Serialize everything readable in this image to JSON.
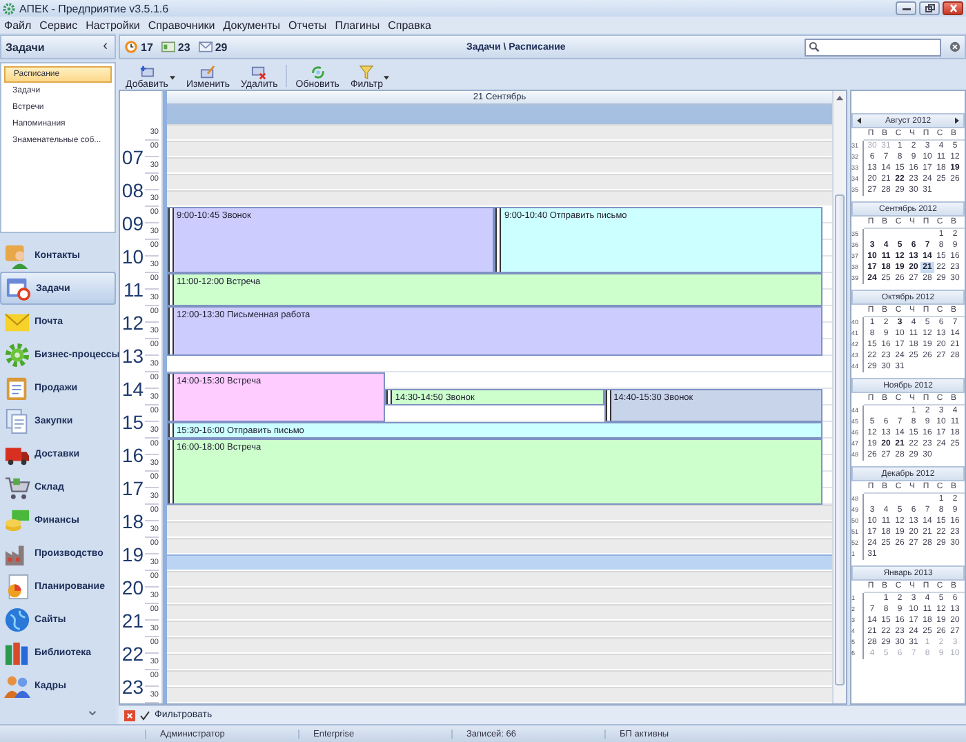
{
  "window": {
    "title": "АПЕК - Предприятие v3.5.1.6"
  },
  "menu": [
    "Файл",
    "Сервис",
    "Настройки",
    "Справочники",
    "Документы",
    "Отчеты",
    "Плагины",
    "Справка"
  ],
  "sidebar": {
    "title": "Задачи",
    "collapse": "‹",
    "tree": [
      {
        "label": "Расписание",
        "selected": true
      },
      {
        "label": "Задачи",
        "selected": false
      },
      {
        "label": "Встречи",
        "selected": false
      },
      {
        "label": "Напоминания",
        "selected": false
      },
      {
        "label": "Знаменательные соб...",
        "selected": false
      }
    ],
    "nav": [
      {
        "label": "Контакты",
        "kind": "person",
        "selected": false
      },
      {
        "label": "Задачи",
        "kind": "calendar",
        "selected": true
      },
      {
        "label": "Почта",
        "kind": "envelope",
        "selected": false
      },
      {
        "label": "Бизнес-процессы",
        "kind": "gear",
        "selected": false
      },
      {
        "label": "Продажи",
        "kind": "clipboard",
        "selected": false
      },
      {
        "label": "Закупки",
        "kind": "documents",
        "selected": false
      },
      {
        "label": "Доставки",
        "kind": "truck",
        "selected": false
      },
      {
        "label": "Склад",
        "kind": "cart",
        "selected": false
      },
      {
        "label": "Финансы",
        "kind": "coins",
        "selected": false
      },
      {
        "label": "Производство",
        "kind": "factory",
        "selected": false
      },
      {
        "label": "Планирование",
        "kind": "piechart",
        "selected": false
      },
      {
        "label": "Сайты",
        "kind": "globe",
        "selected": false
      },
      {
        "label": "Библиотека",
        "kind": "books",
        "selected": false
      },
      {
        "label": "Кадры",
        "kind": "people",
        "selected": false
      }
    ]
  },
  "counters": [
    {
      "kind": "clock",
      "value": "17"
    },
    {
      "kind": "note",
      "value": "23"
    },
    {
      "kind": "envelope",
      "value": "29"
    }
  ],
  "breadcrumb": "Задачи \\ Расписание",
  "toolbar": [
    {
      "label": "Добавить",
      "kind": "add",
      "dropdown": true
    },
    {
      "label": "Изменить",
      "kind": "edit",
      "dropdown": false
    },
    {
      "label": "Удалить",
      "kind": "delete",
      "dropdown": false
    },
    {
      "label": "Обновить",
      "kind": "refresh",
      "dropdown": false
    },
    {
      "label": "Фильтр",
      "kind": "filter",
      "dropdown": true
    }
  ],
  "schedule": {
    "day": "21 Сентябрь",
    "hours": [
      {
        "marks": [
          "30"
        ]
      },
      {
        "hour": "07",
        "marks": [
          "00",
          "30"
        ]
      },
      {
        "hour": "08",
        "marks": [
          "00",
          "30"
        ]
      },
      {
        "hour": "09",
        "marks": [
          "00",
          "30"
        ]
      },
      {
        "hour": "10",
        "marks": [
          "00",
          "30"
        ]
      },
      {
        "hour": "11",
        "marks": [
          "00",
          "30"
        ]
      },
      {
        "hour": "12",
        "marks": [
          "00",
          "30"
        ]
      },
      {
        "hour": "13",
        "marks": [
          "00",
          "30"
        ]
      },
      {
        "hour": "14",
        "marks": [
          "00",
          "30"
        ]
      },
      {
        "hour": "15",
        "marks": [
          "00",
          "30"
        ]
      },
      {
        "hour": "16",
        "marks": [
          "00",
          "30"
        ]
      },
      {
        "hour": "17",
        "marks": [
          "00",
          "30"
        ]
      },
      {
        "hour": "18",
        "marks": [
          "00",
          "30"
        ]
      },
      {
        "hour": "19",
        "marks": [
          "00",
          "30"
        ]
      },
      {
        "hour": "20",
        "marks": [
          "00",
          "30"
        ]
      },
      {
        "hour": "21",
        "marks": [
          "00",
          "30"
        ]
      },
      {
        "hour": "22",
        "marks": [
          "00",
          "30"
        ]
      },
      {
        "hour": "23",
        "marks": [
          "00",
          "30"
        ]
      }
    ],
    "slots": [
      {
        "work": false,
        "selected": false
      },
      {
        "work": false,
        "selected": false
      },
      {
        "work": false,
        "selected": false
      },
      {
        "work": false,
        "selected": false
      },
      {
        "work": false,
        "selected": false
      },
      {
        "work": true,
        "selected": false
      },
      {
        "work": true,
        "selected": false
      },
      {
        "work": true,
        "selected": false
      },
      {
        "work": true,
        "selected": false
      },
      {
        "work": true,
        "selected": false
      },
      {
        "work": true,
        "selected": false
      },
      {
        "work": true,
        "selected": false
      },
      {
        "work": true,
        "selected": false
      },
      {
        "work": true,
        "selected": false
      },
      {
        "work": true,
        "selected": false
      },
      {
        "work": true,
        "selected": false
      },
      {
        "work": true,
        "selected": false
      },
      {
        "work": true,
        "selected": false
      },
      {
        "work": true,
        "selected": false
      },
      {
        "work": true,
        "selected": false
      },
      {
        "work": true,
        "selected": false
      },
      {
        "work": true,
        "selected": false
      },
      {
        "work": true,
        "selected": false
      },
      {
        "work": false,
        "selected": false
      },
      {
        "work": false,
        "selected": false
      },
      {
        "work": false,
        "selected": false
      },
      {
        "work": false,
        "selected": true
      },
      {
        "work": false,
        "selected": false
      },
      {
        "work": false,
        "selected": false
      },
      {
        "work": false,
        "selected": false
      },
      {
        "work": false,
        "selected": false
      },
      {
        "work": false,
        "selected": false
      },
      {
        "work": false,
        "selected": false
      },
      {
        "work": false,
        "selected": false
      },
      {
        "work": false,
        "selected": false
      }
    ],
    "events": [
      {
        "time": "9:00-10:45",
        "title": "Звонок",
        "color": "#ccccff"
      },
      {
        "time": "9:00-10:40",
        "title": "Отправить письмо",
        "color": "#ccffff"
      },
      {
        "time": "11:00-12:00",
        "title": "Встреча",
        "color": "#ccffcc"
      },
      {
        "time": "12:00-13:30",
        "title": "Письменная работа",
        "color": "#ccccff"
      },
      {
        "time": "14:00-15:30",
        "title": "Встреча",
        "color": "#ffccff"
      },
      {
        "time": "14:30-14:50",
        "title": "Звонок",
        "color": "#ccffcc"
      },
      {
        "time": "14:40-15:30",
        "title": "Звонок",
        "color": "#c8d4ea"
      },
      {
        "time": "15:30-16:00",
        "title": "Отправить письмо",
        "color": "#ccffff"
      },
      {
        "time": "16:00-18:00",
        "title": "Встреча",
        "color": "#ccffcc"
      }
    ]
  },
  "calendars": [
    {
      "title": "Август 2012",
      "nav": true,
      "weekdays": [
        "П",
        "В",
        "С",
        "Ч",
        "П",
        "С",
        "В"
      ],
      "weeks": [
        {
          "week": "31",
          "days": [
            {
              "d": "30",
              "kind": "other"
            },
            {
              "d": "31",
              "kind": "other"
            },
            {
              "d": "1",
              "kind": "day"
            },
            {
              "d": "2",
              "kind": "day"
            },
            {
              "d": "3",
              "kind": "day"
            },
            {
              "d": "4",
              "kind": "day"
            },
            {
              "d": "5",
              "kind": "day"
            }
          ]
        },
        {
          "week": "32",
          "days": [
            {
              "d": "6",
              "kind": "day"
            },
            {
              "d": "7",
              "kind": "day"
            },
            {
              "d": "8",
              "kind": "day"
            },
            {
              "d": "9",
              "kind": "day"
            },
            {
              "d": "10",
              "kind": "day"
            },
            {
              "d": "11",
              "kind": "day"
            },
            {
              "d": "12",
              "kind": "day"
            }
          ]
        },
        {
          "week": "33",
          "days": [
            {
              "d": "13",
              "kind": "day"
            },
            {
              "d": "14",
              "kind": "day"
            },
            {
              "d": "15",
              "kind": "day"
            },
            {
              "d": "16",
              "kind": "day"
            },
            {
              "d": "17",
              "kind": "day"
            },
            {
              "d": "18",
              "kind": "day"
            },
            {
              "d": "19",
              "kind": "busy"
            }
          ]
        },
        {
          "week": "34",
          "days": [
            {
              "d": "20",
              "kind": "day"
            },
            {
              "d": "21",
              "kind": "day"
            },
            {
              "d": "22",
              "kind": "busy"
            },
            {
              "d": "23",
              "kind": "day"
            },
            {
              "d": "24",
              "kind": "day"
            },
            {
              "d": "25",
              "kind": "day"
            },
            {
              "d": "26",
              "kind": "day"
            }
          ]
        },
        {
          "week": "35",
          "days": [
            {
              "d": "27",
              "kind": "day"
            },
            {
              "d": "28",
              "kind": "day"
            },
            {
              "d": "29",
              "kind": "day"
            },
            {
              "d": "30",
              "kind": "day"
            },
            {
              "d": "31",
              "kind": "day"
            }
          ]
        }
      ]
    },
    {
      "title": "Сентябрь 2012",
      "nav": false,
      "weekdays": [
        "П",
        "В",
        "С",
        "Ч",
        "П",
        "С",
        "В"
      ],
      "weeks": [
        {
          "week": "35",
          "days": [
            {
              "kind": "blank"
            },
            {
              "kind": "blank"
            },
            {
              "kind": "blank"
            },
            {
              "kind": "blank"
            },
            {
              "kind": "blank"
            },
            {
              "d": "1",
              "kind": "day"
            },
            {
              "d": "2",
              "kind": "day"
            }
          ]
        },
        {
          "week": "36",
          "days": [
            {
              "d": "3",
              "kind": "busy"
            },
            {
              "d": "4",
              "kind": "busy"
            },
            {
              "d": "5",
              "kind": "busy"
            },
            {
              "d": "6",
              "kind": "busy"
            },
            {
              "d": "7",
              "kind": "busy"
            },
            {
              "d": "8",
              "kind": "day"
            },
            {
              "d": "9",
              "kind": "day"
            }
          ]
        },
        {
          "week": "37",
          "days": [
            {
              "d": "10",
              "kind": "busy"
            },
            {
              "d": "11",
              "kind": "busy"
            },
            {
              "d": "12",
              "kind": "busy"
            },
            {
              "d": "13",
              "kind": "busy"
            },
            {
              "d": "14",
              "kind": "busy"
            },
            {
              "d": "15",
              "kind": "day"
            },
            {
              "d": "16",
              "kind": "day"
            }
          ]
        },
        {
          "week": "38",
          "days": [
            {
              "d": "17",
              "kind": "busy"
            },
            {
              "d": "18",
              "kind": "busy"
            },
            {
              "d": "19",
              "kind": "busy"
            },
            {
              "d": "20",
              "kind": "busy"
            },
            {
              "d": "21",
              "kind": "today"
            },
            {
              "d": "22",
              "kind": "day"
            },
            {
              "d": "23",
              "kind": "day"
            }
          ]
        },
        {
          "week": "39",
          "days": [
            {
              "d": "24",
              "kind": "busy"
            },
            {
              "d": "25",
              "kind": "day"
            },
            {
              "d": "26",
              "kind": "day"
            },
            {
              "d": "27",
              "kind": "day"
            },
            {
              "d": "28",
              "kind": "day"
            },
            {
              "d": "29",
              "kind": "day"
            },
            {
              "d": "30",
              "kind": "day"
            }
          ]
        }
      ]
    },
    {
      "title": "Октябрь 2012",
      "nav": false,
      "weekdays": [
        "П",
        "В",
        "С",
        "Ч",
        "П",
        "С",
        "В"
      ],
      "weeks": [
        {
          "week": "40",
          "days": [
            {
              "d": "1",
              "kind": "day"
            },
            {
              "d": "2",
              "kind": "day"
            },
            {
              "d": "3",
              "kind": "busy"
            },
            {
              "d": "4",
              "kind": "day"
            },
            {
              "d": "5",
              "kind": "day"
            },
            {
              "d": "6",
              "kind": "day"
            },
            {
              "d": "7",
              "kind": "day"
            }
          ]
        },
        {
          "week": "41",
          "days": [
            {
              "d": "8",
              "kind": "day"
            },
            {
              "d": "9",
              "kind": "day"
            },
            {
              "d": "10",
              "kind": "day"
            },
            {
              "d": "11",
              "kind": "day"
            },
            {
              "d": "12",
              "kind": "day"
            },
            {
              "d": "13",
              "kind": "day"
            },
            {
              "d": "14",
              "kind": "day"
            }
          ]
        },
        {
          "week": "42",
          "days": [
            {
              "d": "15",
              "kind": "day"
            },
            {
              "d": "16",
              "kind": "day"
            },
            {
              "d": "17",
              "kind": "day"
            },
            {
              "d": "18",
              "kind": "day"
            },
            {
              "d": "19",
              "kind": "day"
            },
            {
              "d": "20",
              "kind": "day"
            },
            {
              "d": "21",
              "kind": "day"
            }
          ]
        },
        {
          "week": "43",
          "days": [
            {
              "d": "22",
              "kind": "day"
            },
            {
              "d": "23",
              "kind": "day"
            },
            {
              "d": "24",
              "kind": "day"
            },
            {
              "d": "25",
              "kind": "day"
            },
            {
              "d": "26",
              "kind": "day"
            },
            {
              "d": "27",
              "kind": "day"
            },
            {
              "d": "28",
              "kind": "day"
            }
          ]
        },
        {
          "week": "44",
          "days": [
            {
              "d": "29",
              "kind": "day"
            },
            {
              "d": "30",
              "kind": "day"
            },
            {
              "d": "31",
              "kind": "day"
            }
          ]
        }
      ]
    },
    {
      "title": "Ноябрь 2012",
      "nav": false,
      "weekdays": [
        "П",
        "В",
        "С",
        "Ч",
        "П",
        "С",
        "В"
      ],
      "weeks": [
        {
          "week": "44",
          "days": [
            {
              "kind": "blank"
            },
            {
              "kind": "blank"
            },
            {
              "kind": "blank"
            },
            {
              "d": "1",
              "kind": "day"
            },
            {
              "d": "2",
              "kind": "day"
            },
            {
              "d": "3",
              "kind": "day"
            },
            {
              "d": "4",
              "kind": "day"
            }
          ]
        },
        {
          "week": "45",
          "days": [
            {
              "d": "5",
              "kind": "day"
            },
            {
              "d": "6",
              "kind": "day"
            },
            {
              "d": "7",
              "kind": "day"
            },
            {
              "d": "8",
              "kind": "day"
            },
            {
              "d": "9",
              "kind": "day"
            },
            {
              "d": "10",
              "kind": "day"
            },
            {
              "d": "11",
              "kind": "day"
            }
          ]
        },
        {
          "week": "46",
          "days": [
            {
              "d": "12",
              "kind": "day"
            },
            {
              "d": "13",
              "kind": "day"
            },
            {
              "d": "14",
              "kind": "day"
            },
            {
              "d": "15",
              "kind": "day"
            },
            {
              "d": "16",
              "kind": "day"
            },
            {
              "d": "17",
              "kind": "day"
            },
            {
              "d": "18",
              "kind": "day"
            }
          ]
        },
        {
          "week": "47",
          "days": [
            {
              "d": "19",
              "kind": "day"
            },
            {
              "d": "20",
              "kind": "busy"
            },
            {
              "d": "21",
              "kind": "busy"
            },
            {
              "d": "22",
              "kind": "day"
            },
            {
              "d": "23",
              "kind": "day"
            },
            {
              "d": "24",
              "kind": "day"
            },
            {
              "d": "25",
              "kind": "day"
            }
          ]
        },
        {
          "week": "48",
          "days": [
            {
              "d": "26",
              "kind": "day"
            },
            {
              "d": "27",
              "kind": "day"
            },
            {
              "d": "28",
              "kind": "day"
            },
            {
              "d": "29",
              "kind": "day"
            },
            {
              "d": "30",
              "kind": "day"
            }
          ]
        }
      ]
    },
    {
      "title": "Декабрь 2012",
      "nav": false,
      "weekdays": [
        "П",
        "В",
        "С",
        "Ч",
        "П",
        "С",
        "В"
      ],
      "weeks": [
        {
          "week": "48",
          "days": [
            {
              "kind": "blank"
            },
            {
              "kind": "blank"
            },
            {
              "kind": "blank"
            },
            {
              "kind": "blank"
            },
            {
              "kind": "blank"
            },
            {
              "d": "1",
              "kind": "day"
            },
            {
              "d": "2",
              "kind": "day"
            }
          ]
        },
        {
          "week": "49",
          "days": [
            {
              "d": "3",
              "kind": "day"
            },
            {
              "d": "4",
              "kind": "day"
            },
            {
              "d": "5",
              "kind": "day"
            },
            {
              "d": "6",
              "kind": "day"
            },
            {
              "d": "7",
              "kind": "day"
            },
            {
              "d": "8",
              "kind": "day"
            },
            {
              "d": "9",
              "kind": "day"
            }
          ]
        },
        {
          "week": "50",
          "days": [
            {
              "d": "10",
              "kind": "day"
            },
            {
              "d": "11",
              "kind": "day"
            },
            {
              "d": "12",
              "kind": "day"
            },
            {
              "d": "13",
              "kind": "day"
            },
            {
              "d": "14",
              "kind": "day"
            },
            {
              "d": "15",
              "kind": "day"
            },
            {
              "d": "16",
              "kind": "day"
            }
          ]
        },
        {
          "week": "51",
          "days": [
            {
              "d": "17",
              "kind": "day"
            },
            {
              "d": "18",
              "kind": "day"
            },
            {
              "d": "19",
              "kind": "day"
            },
            {
              "d": "20",
              "kind": "day"
            },
            {
              "d": "21",
              "kind": "day"
            },
            {
              "d": "22",
              "kind": "day"
            },
            {
              "d": "23",
              "kind": "day"
            }
          ]
        },
        {
          "week": "52",
          "days": [
            {
              "d": "24",
              "kind": "day"
            },
            {
              "d": "25",
              "kind": "day"
            },
            {
              "d": "26",
              "kind": "day"
            },
            {
              "d": "27",
              "kind": "day"
            },
            {
              "d": "28",
              "kind": "day"
            },
            {
              "d": "29",
              "kind": "day"
            },
            {
              "d": "30",
              "kind": "day"
            }
          ]
        },
        {
          "week": "1",
          "days": [
            {
              "d": "31",
              "kind": "day"
            }
          ]
        }
      ]
    },
    {
      "title": "Январь 2013",
      "nav": false,
      "weekdays": [
        "П",
        "В",
        "С",
        "Ч",
        "П",
        "С",
        "В"
      ],
      "weeks": [
        {
          "week": "1",
          "days": [
            {
              "kind": "blank"
            },
            {
              "d": "1",
              "kind": "day"
            },
            {
              "d": "2",
              "kind": "day"
            },
            {
              "d": "3",
              "kind": "day"
            },
            {
              "d": "4",
              "kind": "day"
            },
            {
              "d": "5",
              "kind": "day"
            },
            {
              "d": "6",
              "kind": "day"
            }
          ]
        },
        {
          "week": "2",
          "days": [
            {
              "d": "7",
              "kind": "day"
            },
            {
              "d": "8",
              "kind": "day"
            },
            {
              "d": "9",
              "kind": "day"
            },
            {
              "d": "10",
              "kind": "day"
            },
            {
              "d": "11",
              "kind": "day"
            },
            {
              "d": "12",
              "kind": "day"
            },
            {
              "d": "13",
              "kind": "day"
            }
          ]
        },
        {
          "week": "3",
          "days": [
            {
              "d": "14",
              "kind": "day"
            },
            {
              "d": "15",
              "kind": "day"
            },
            {
              "d": "16",
              "kind": "day"
            },
            {
              "d": "17",
              "kind": "day"
            },
            {
              "d": "18",
              "kind": "day"
            },
            {
              "d": "19",
              "kind": "day"
            },
            {
              "d": "20",
              "kind": "day"
            }
          ]
        },
        {
          "week": "4",
          "days": [
            {
              "d": "21",
              "kind": "day"
            },
            {
              "d": "22",
              "kind": "day"
            },
            {
              "d": "23",
              "kind": "day"
            },
            {
              "d": "24",
              "kind": "day"
            },
            {
              "d": "25",
              "kind": "day"
            },
            {
              "d": "26",
              "kind": "day"
            },
            {
              "d": "27",
              "kind": "day"
            }
          ]
        },
        {
          "week": "5",
          "days": [
            {
              "d": "28",
              "kind": "day"
            },
            {
              "d": "29",
              "kind": "day"
            },
            {
              "d": "30",
              "kind": "day"
            },
            {
              "d": "31",
              "kind": "day"
            },
            {
              "d": "1",
              "kind": "other"
            },
            {
              "d": "2",
              "kind": "other"
            },
            {
              "d": "3",
              "kind": "other"
            }
          ]
        },
        {
          "week": "6",
          "days": [
            {
              "d": "4",
              "kind": "other"
            },
            {
              "d": "5",
              "kind": "other"
            },
            {
              "d": "6",
              "kind": "other"
            },
            {
              "d": "7",
              "kind": "other"
            },
            {
              "d": "8",
              "kind": "other"
            },
            {
              "d": "9",
              "kind": "other"
            },
            {
              "d": "10",
              "kind": "other"
            }
          ]
        }
      ]
    }
  ],
  "filter_bar": {
    "label": "Фильтровать",
    "checked": true
  },
  "status_bar": [
    "Администратор",
    "Enterprise",
    "Записей: 66",
    "БП активны"
  ]
}
